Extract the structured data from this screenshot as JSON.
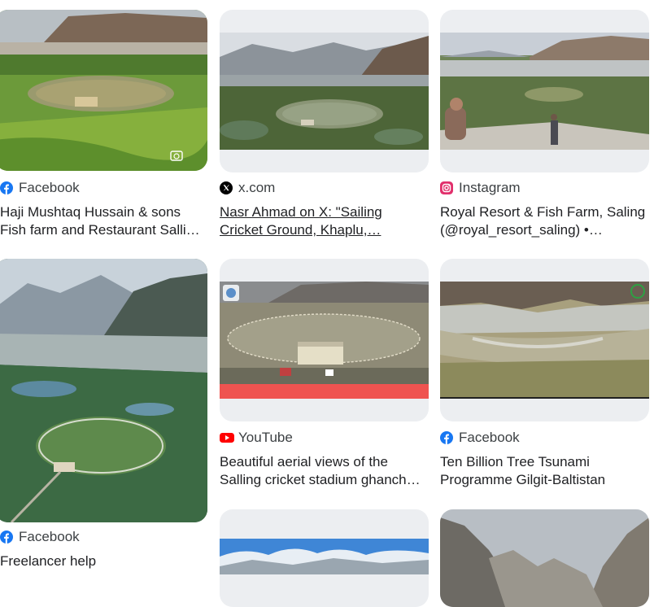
{
  "results": [
    {
      "source": "Facebook",
      "source_icon": "facebook-icon",
      "title_lines": [
        "Haji Mushtaq Hussain & sons",
        "Fish farm and Restaurant Sallin…"
      ],
      "image": "aerial-green-valley-cricket-ground"
    },
    {
      "source": "x.com",
      "source_icon": "x-logo-icon",
      "title_lines": [
        "Nasr Ahmad on X: \"Sailing",
        "Cricket Ground, Khaplu,…"
      ],
      "image": "aerial-cricket-ground-mountains"
    },
    {
      "source": "Instagram",
      "source_icon": "instagram-icon",
      "title_lines": [
        "Royal Resort & Fish Farm, Saling",
        "(@royal_resort_saling) •…"
      ],
      "image": "people-overlooking-valley"
    },
    {
      "source": "Facebook",
      "source_icon": "facebook-icon",
      "title_lines": [
        "Freelancer help"
      ],
      "image": "aerial-valley-circular-field"
    },
    {
      "source": "YouTube",
      "source_icon": "youtube-icon",
      "title_lines": [
        "Beautiful aerial views of the",
        "Salling cricket stadium ghanch…"
      ],
      "image": "drone-footage-cricket-stadium"
    },
    {
      "source": "Facebook",
      "source_icon": "facebook-icon",
      "title_lines": [
        "Ten Billion Tree Tsunami",
        "Programme Gilgit-Baltistan"
      ],
      "image": "river-delta-mountains"
    },
    {
      "image": "aerial-blue-sky-mountains"
    },
    {
      "image": "gray-mountain-gorge"
    }
  ],
  "colors": {
    "facebook": "#1877f2",
    "youtube": "#ff0000",
    "instagram": "#e1306c",
    "x": "#000000"
  }
}
